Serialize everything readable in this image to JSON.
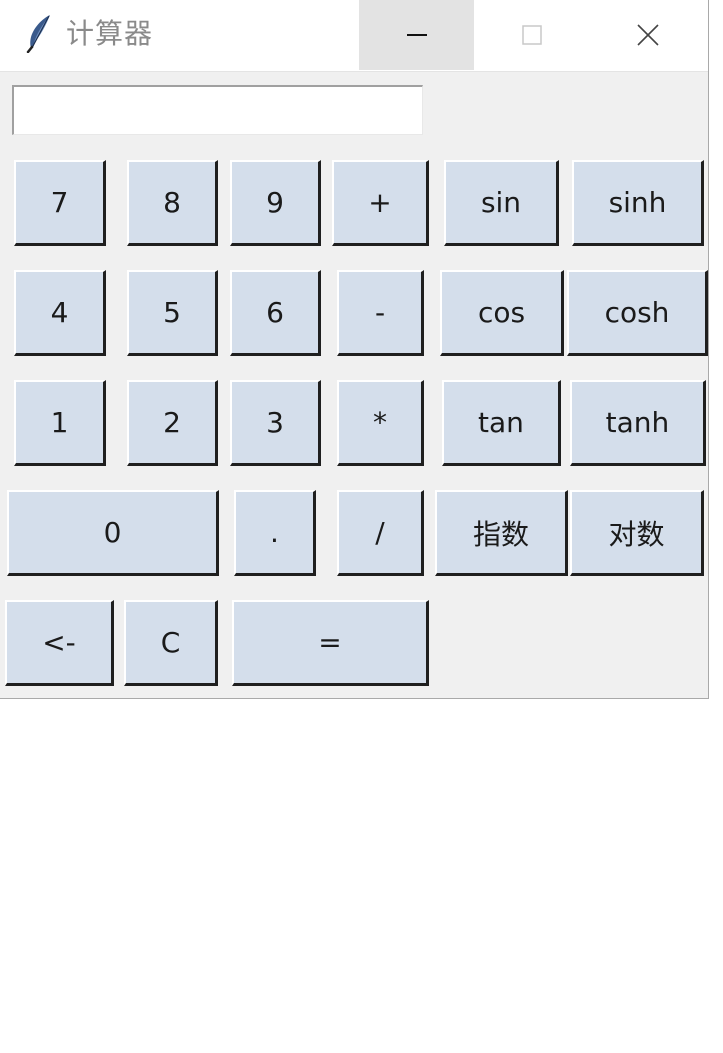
{
  "window": {
    "title": "计算器",
    "icon": "feather-icon",
    "controls": {
      "minimize_icon": "minimize-icon",
      "maximize_icon": "maximize-icon",
      "close_icon": "close-icon"
    }
  },
  "display": {
    "value": ""
  },
  "buttons": {
    "b7": "7",
    "b8": "8",
    "b9": "9",
    "plus": "+",
    "sin": "sin",
    "sinh": "sinh",
    "b4": "4",
    "b5": "5",
    "b6": "6",
    "minus": "-",
    "cos": "cos",
    "cosh": "cosh",
    "b1": "1",
    "b2": "2",
    "b3": "3",
    "multiply": "*",
    "tan": "tan",
    "tanh": "tanh",
    "b0": "0",
    "dot": ".",
    "divide": "/",
    "exp": "指数",
    "log": "对数",
    "backspace": "<-",
    "clear": "C",
    "equals": "="
  },
  "colors": {
    "button_face": "#d4deeb",
    "window_bg": "#f0f0f0",
    "titlebar_bg": "#ffffff",
    "minimize_hover": "#e3e3e3"
  }
}
